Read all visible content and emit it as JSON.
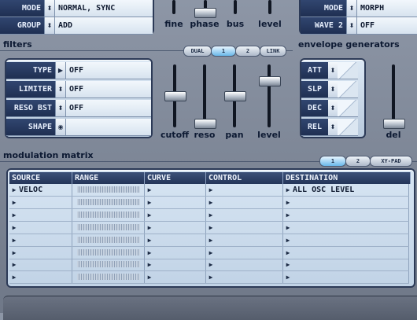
{
  "osc_panel": {
    "rows": [
      {
        "label": "MODE",
        "value": "NORMAL, SYNC"
      },
      {
        "label": "GROUP",
        "value": "ADD"
      }
    ],
    "knob_labels": [
      "fine",
      "phase",
      "bus",
      "level"
    ]
  },
  "wave_panel": {
    "rows": [
      {
        "label": "MODE",
        "value": "MORPH"
      },
      {
        "label": "WAVE 2",
        "value": "OFF"
      }
    ]
  },
  "filters": {
    "title": "filters",
    "tabs": [
      "DUAL",
      "1",
      "2",
      "LINK"
    ],
    "rows": [
      {
        "label": "TYPE",
        "value": "OFF"
      },
      {
        "label": "LIMITER",
        "value": "OFF"
      },
      {
        "label": "RESO BST",
        "value": "OFF"
      },
      {
        "label": "SHAPE",
        "value": ""
      }
    ],
    "knob_labels": [
      "cutoff",
      "reso",
      "pan",
      "level"
    ]
  },
  "envelope": {
    "title": "envelope generators",
    "buttons": [
      "ATT",
      "SLP",
      "DEC",
      "REL"
    ],
    "knob_label": "del"
  },
  "matrix": {
    "title": "modulation matrix",
    "tabs": [
      "1",
      "2",
      "XY-PAD"
    ],
    "columns": [
      "SOURCE",
      "RANGE",
      "CURVE",
      "CONTROL",
      "DESTINATION"
    ],
    "rows": [
      {
        "source": "VELOC",
        "destination": "ALL OSC LEVEL"
      },
      {
        "source": "",
        "destination": ""
      },
      {
        "source": "",
        "destination": ""
      },
      {
        "source": "",
        "destination": ""
      },
      {
        "source": "",
        "destination": ""
      },
      {
        "source": "",
        "destination": ""
      },
      {
        "source": "",
        "destination": ""
      },
      {
        "source": "",
        "destination": ""
      }
    ]
  },
  "icons": {
    "arrow": "right-triangle-icon",
    "updown": "up-down-arrow-icon",
    "eye": "eye-icon"
  }
}
